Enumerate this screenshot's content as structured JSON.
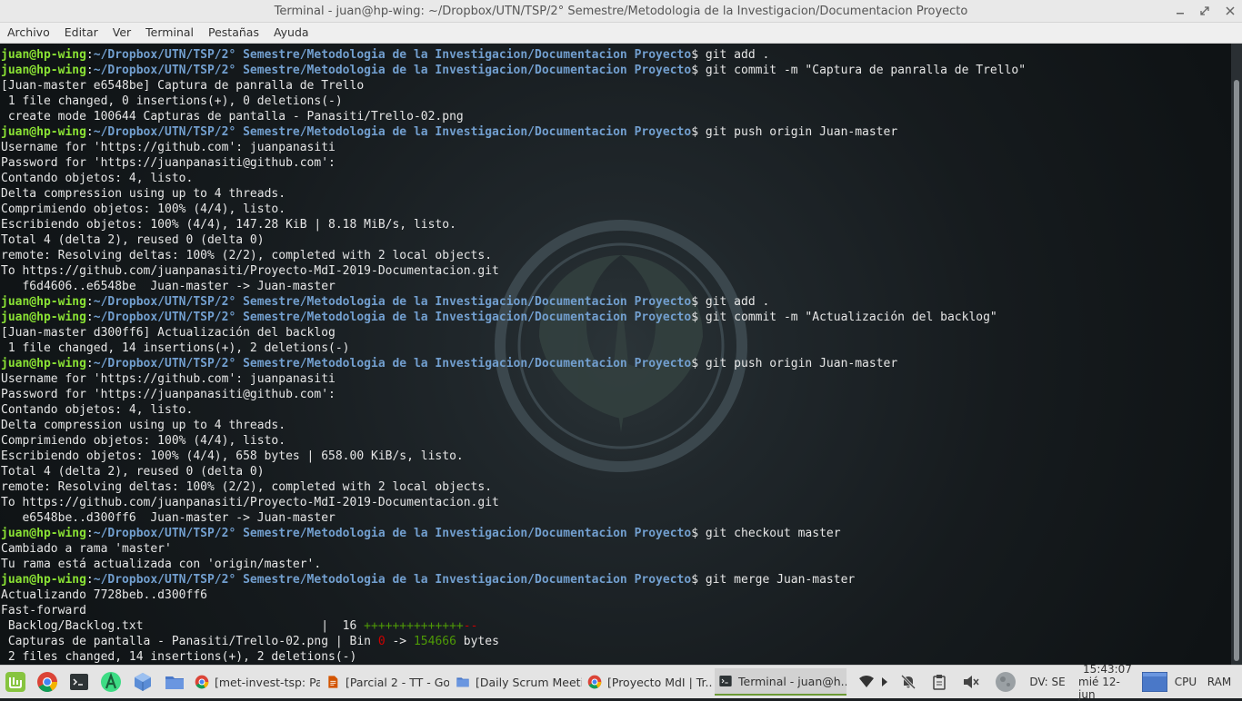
{
  "window": {
    "title": "Terminal - juan@hp-wing: ~/Dropbox/UTN/TSP/2° Semestre/Metodologia de la Investigacion/Documentacion Proyecto"
  },
  "menu": [
    "Archivo",
    "Editar",
    "Ver",
    "Terminal",
    "Pestañas",
    "Ayuda"
  ],
  "prompt": {
    "user": "juan@hp-wing",
    "path": "~/Dropbox/UTN/TSP/2° Semestre/Metodologia de la Investigacion/Documentacion Proyecto"
  },
  "terminal_lines": [
    {
      "type": "cmd",
      "text": "git add ."
    },
    {
      "type": "cmd",
      "text": "git commit -m \"Captura de panralla de Trello\""
    },
    {
      "type": "out",
      "text": "[Juan-master e6548be] Captura de panralla de Trello"
    },
    {
      "type": "out",
      "text": " 1 file changed, 0 insertions(+), 0 deletions(-)"
    },
    {
      "type": "out",
      "text": " create mode 100644 Capturas de pantalla - Panasiti/Trello-02.png"
    },
    {
      "type": "cmd",
      "text": "git push origin Juan-master"
    },
    {
      "type": "out",
      "text": "Username for 'https://github.com': juanpanasiti"
    },
    {
      "type": "out",
      "text": "Password for 'https://juanpanasiti@github.com':"
    },
    {
      "type": "out",
      "text": "Contando objetos: 4, listo."
    },
    {
      "type": "out",
      "text": "Delta compression using up to 4 threads."
    },
    {
      "type": "out",
      "text": "Comprimiendo objetos: 100% (4/4), listo."
    },
    {
      "type": "out",
      "text": "Escribiendo objetos: 100% (4/4), 147.28 KiB | 8.18 MiB/s, listo."
    },
    {
      "type": "out",
      "text": "Total 4 (delta 2), reused 0 (delta 0)"
    },
    {
      "type": "out",
      "text": "remote: Resolving deltas: 100% (2/2), completed with 2 local objects."
    },
    {
      "type": "out",
      "text": "To https://github.com/juanpanasiti/Proyecto-MdI-2019-Documentacion.git"
    },
    {
      "type": "out",
      "text": "   f6d4606..e6548be  Juan-master -> Juan-master"
    },
    {
      "type": "cmd",
      "text": "git add ."
    },
    {
      "type": "cmd",
      "text": "git commit -m \"Actualización del backlog\""
    },
    {
      "type": "out",
      "text": "[Juan-master d300ff6] Actualización del backlog"
    },
    {
      "type": "out",
      "text": " 1 file changed, 14 insertions(+), 2 deletions(-)"
    },
    {
      "type": "cmd",
      "text": "git push origin Juan-master"
    },
    {
      "type": "out",
      "text": "Username for 'https://github.com': juanpanasiti"
    },
    {
      "type": "out",
      "text": "Password for 'https://juanpanasiti@github.com':"
    },
    {
      "type": "out",
      "text": "Contando objetos: 4, listo."
    },
    {
      "type": "out",
      "text": "Delta compression using up to 4 threads."
    },
    {
      "type": "out",
      "text": "Comprimiendo objetos: 100% (4/4), listo."
    },
    {
      "type": "out",
      "text": "Escribiendo objetos: 100% (4/4), 658 bytes | 658.00 KiB/s, listo."
    },
    {
      "type": "out",
      "text": "Total 4 (delta 2), reused 0 (delta 0)"
    },
    {
      "type": "out",
      "text": "remote: Resolving deltas: 100% (2/2), completed with 2 local objects."
    },
    {
      "type": "out",
      "text": "To https://github.com/juanpanasiti/Proyecto-MdI-2019-Documentacion.git"
    },
    {
      "type": "out",
      "text": "   e6548be..d300ff6  Juan-master -> Juan-master"
    },
    {
      "type": "cmd",
      "text": "git checkout master"
    },
    {
      "type": "out",
      "text": "Cambiado a rama 'master'"
    },
    {
      "type": "out",
      "text": "Tu rama está actualizada con 'origin/master'."
    },
    {
      "type": "cmd",
      "text": "git merge Juan-master"
    },
    {
      "type": "out",
      "text": "Actualizando 7728beb..d300ff6"
    },
    {
      "type": "out",
      "text": "Fast-forward"
    },
    {
      "type": "diffstat",
      "file": " Backlog/Backlog.txt                         ",
      "count": "  16 ",
      "plus": "++++++++++++++",
      "minus": "--"
    },
    {
      "type": "binstat",
      "file": " Capturas de pantalla - Panasiti/Trello-02.png",
      "pre": " Bin ",
      "old": "0",
      "arrow": " -> ",
      "new": "154666",
      "post": " bytes"
    },
    {
      "type": "out",
      "text": " 2 files changed, 14 insertions(+), 2 deletions(-)"
    }
  ],
  "taskbar": {
    "windows": [
      {
        "label": "[met-invest-tsp: Pa...",
        "icon": "chrome-icon"
      },
      {
        "label": "[Parcial 2 - TT - Go...",
        "icon": "document-icon"
      },
      {
        "label": "[Daily Scrum Meeti...",
        "icon": "folder-icon"
      },
      {
        "label": "[Proyecto MdI | Tr...",
        "icon": "chrome-icon"
      },
      {
        "label": "Terminal - juan@h...",
        "icon": "terminal-icon"
      }
    ],
    "keyboard_layout": "DV: SE",
    "clock_time": "15:43:07",
    "clock_date": "mié 12-jun",
    "cpu_label": "CPU",
    "ram_label": "RAM"
  }
}
